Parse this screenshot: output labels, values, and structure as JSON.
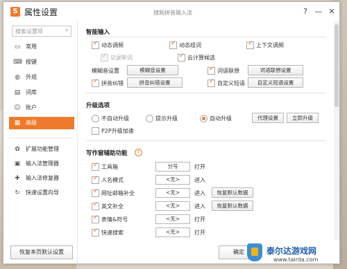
{
  "window": {
    "title": "属性设置",
    "center_title": "搜狗拼音输入法",
    "help_btn": "?",
    "min_btn": "—",
    "close_btn": "✕",
    "logo": "S"
  },
  "sidebar": {
    "search_placeholder": "搜索设置项",
    "items": [
      {
        "label": "常用",
        "icon": "monitor-icon"
      },
      {
        "label": "按键",
        "icon": "keyboard-icon"
      },
      {
        "label": "外观",
        "icon": "appearance-icon"
      },
      {
        "label": "词库",
        "icon": "dictionary-icon"
      },
      {
        "label": "账户",
        "icon": "account-icon"
      },
      {
        "label": "高级",
        "icon": "advanced-icon"
      }
    ],
    "tools": [
      {
        "label": "扩展功能管理",
        "icon": "extension-icon"
      },
      {
        "label": "输入法管理器",
        "icon": "manager-icon"
      },
      {
        "label": "输入法修复器",
        "icon": "repair-icon"
      },
      {
        "label": "快速设置向导",
        "icon": "wizard-icon"
      }
    ]
  },
  "smart_input": {
    "title": "智能输入",
    "dynamic_freq": "动态调频",
    "dynamic_words": "动态组词",
    "context_freq": "上下文调频",
    "record_new_words": "记录新词",
    "cloud_candidates": "云计算候选",
    "fuzzy_label": "模糊音设置",
    "fuzzy_btn": "模糊音设置",
    "association": "词语联想",
    "association_btn": "词语联想设置",
    "pinyin_fix": "拼音纠错",
    "pinyin_fix_btn": "拼音纠错设置",
    "custom_phrase": "自定义短语",
    "custom_phrase_btn": "自定义短语设置"
  },
  "upgrade": {
    "title": "升级选项",
    "no_auto": "不自动升级",
    "prompt": "提示升级",
    "auto": "自动升级",
    "proxy_btn": "代理设置",
    "upgrade_now_btn": "立即升级",
    "p2p": "P2P升级加速"
  },
  "writing": {
    "title": "写作窗辅助功能",
    "help": "?",
    "rows": [
      {
        "label": "工具箱",
        "value": "分号",
        "action": "打开",
        "restore": ""
      },
      {
        "label": "人名模式",
        "value": "<无>",
        "action": "进入",
        "restore": ""
      },
      {
        "label": "网址邮箱补全",
        "value": "<无>",
        "action": "进入",
        "restore": "恢复默认数据"
      },
      {
        "label": "英文补全",
        "value": "<无>",
        "action": "进入",
        "restore": "恢复默认数据"
      },
      {
        "label": "表情&符号",
        "value": "<无>",
        "action": "打开",
        "restore": ""
      },
      {
        "label": "快速搜索",
        "value": "<无>",
        "action": "打开",
        "restore": ""
      }
    ]
  },
  "footer": {
    "restore_btn": "恢复本页默认设置",
    "ok_btn": "确定"
  },
  "watermark": {
    "title": "泰尔达游戏网",
    "url": "www.tairda.com"
  },
  "colors": {
    "accent": "#f07a2c"
  }
}
